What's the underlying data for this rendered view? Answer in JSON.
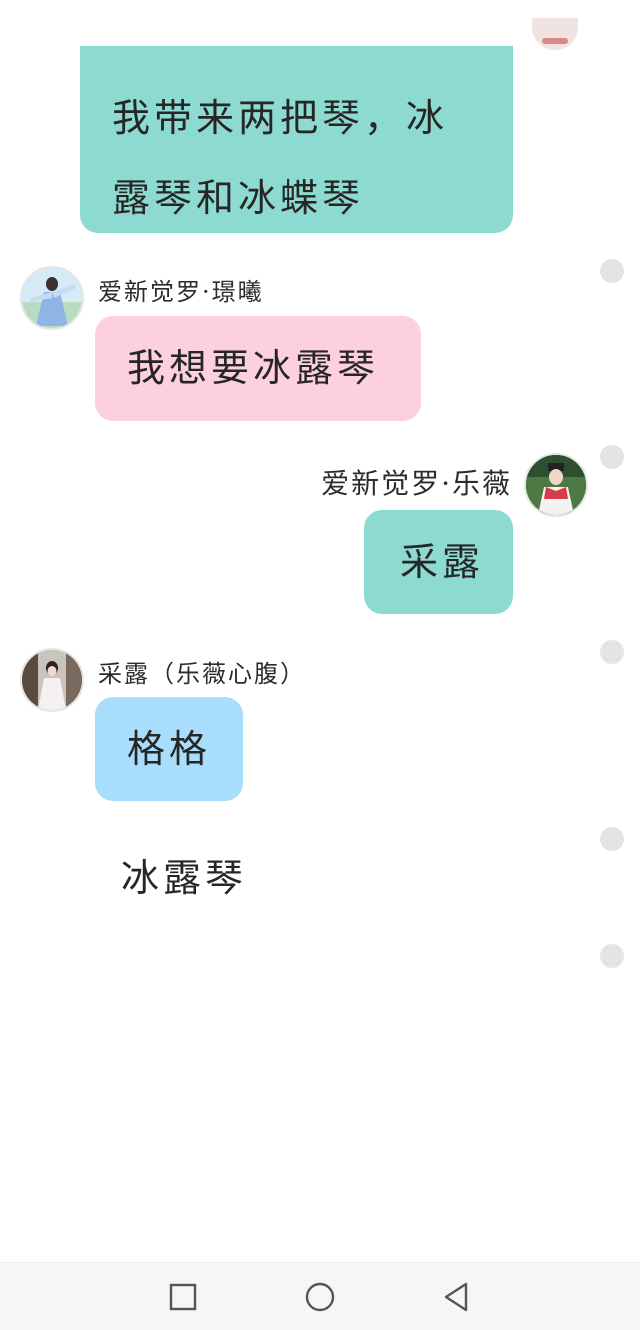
{
  "chat": {
    "messages": [
      {
        "side": "right",
        "text_lines": [
          "我带来两把琴，冰",
          "露琴和冰蝶琴"
        ],
        "bubble_color": "#8ddbd0"
      },
      {
        "side": "left",
        "sender": "爱新觉罗·璟曦",
        "text": "我想要冰露琴",
        "bubble_color": "#fcd0dc"
      },
      {
        "side": "right",
        "sender": "爱新觉罗·乐薇",
        "text": "采露",
        "bubble_color": "#8ddbd0"
      },
      {
        "side": "left",
        "sender": "采露（乐薇心腹）",
        "text": "格格",
        "bubble_color": "#a8defc"
      },
      {
        "side": "left",
        "text": "冰露琴",
        "bubble_color": "#ffffff"
      }
    ]
  },
  "icons": {
    "nav_recent": "square-icon",
    "nav_home": "circle-icon",
    "nav_back": "triangle-back-icon",
    "avatar_left_1": "avatar-girl-blue-dress",
    "avatar_right": "avatar-girl-red-costume",
    "avatar_left_2": "avatar-girl-white-dress"
  }
}
